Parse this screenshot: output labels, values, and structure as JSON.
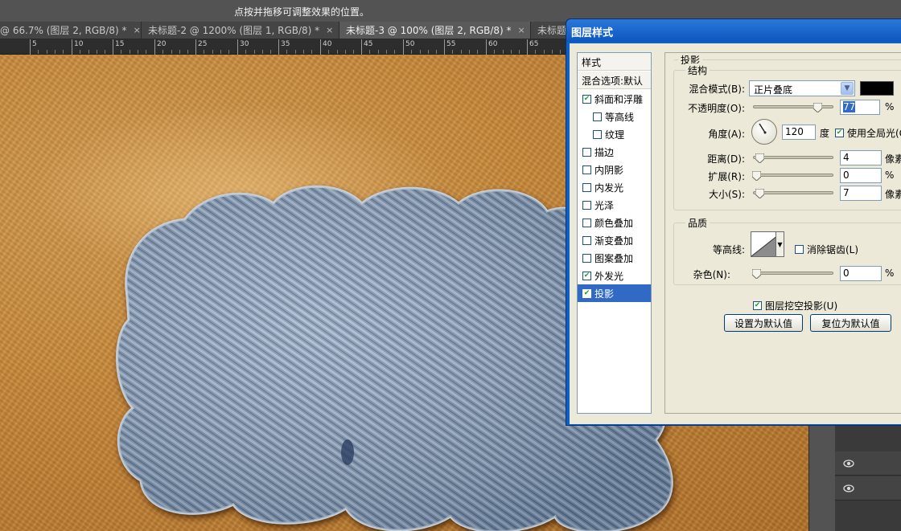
{
  "hint": "点按并拖移可调整效果的位置。",
  "tabs": [
    {
      "label": "@ 66.7% (图层 2, RGB/8) *",
      "close": "×"
    },
    {
      "label": "未标题-2 @ 1200% (图层 1, RGB/8) *",
      "close": "×"
    },
    {
      "label": "未标题-3 @ 100% (图层 2, RGB/8) *",
      "close": "×"
    },
    {
      "label": "未标题",
      "close": ""
    }
  ],
  "ruler": [
    "5",
    "10",
    "15",
    "20",
    "25",
    "30",
    "35",
    "40",
    "45",
    "50",
    "55",
    "60",
    "65"
  ],
  "dialog": {
    "title": "图层样式",
    "styles_header": "样式",
    "blend_options": "混合选项:默认",
    "items": [
      {
        "label": "斜面和浮雕",
        "checked": true,
        "indent": false,
        "selected": false
      },
      {
        "label": "等高线",
        "checked": false,
        "indent": true,
        "selected": false
      },
      {
        "label": "纹理",
        "checked": false,
        "indent": true,
        "selected": false
      },
      {
        "label": "描边",
        "checked": false,
        "indent": false,
        "selected": false
      },
      {
        "label": "内阴影",
        "checked": false,
        "indent": false,
        "selected": false
      },
      {
        "label": "内发光",
        "checked": false,
        "indent": false,
        "selected": false
      },
      {
        "label": "光泽",
        "checked": false,
        "indent": false,
        "selected": false
      },
      {
        "label": "颜色叠加",
        "checked": false,
        "indent": false,
        "selected": false
      },
      {
        "label": "渐变叠加",
        "checked": false,
        "indent": false,
        "selected": false
      },
      {
        "label": "图案叠加",
        "checked": false,
        "indent": false,
        "selected": false
      },
      {
        "label": "外发光",
        "checked": true,
        "indent": false,
        "selected": false
      },
      {
        "label": "投影",
        "checked": true,
        "indent": false,
        "selected": true
      }
    ],
    "section_title": "投影",
    "structure": {
      "legend": "结构",
      "blend_mode_label": "混合模式(B):",
      "blend_mode_value": "正片叠底",
      "blend_color": "#000000",
      "opacity_label": "不透明度(O):",
      "opacity_value": "77",
      "opacity_unit": "%",
      "angle_label": "角度(A):",
      "angle_value": "120",
      "angle_unit": "度",
      "global_light_label": "使用全局光(G)",
      "global_light_checked": true,
      "distance_label": "距离(D):",
      "distance_value": "4",
      "distance_unit": "像素",
      "spread_label": "扩展(R):",
      "spread_value": "0",
      "spread_unit": "%",
      "size_label": "大小(S):",
      "size_value": "7",
      "size_unit": "像素"
    },
    "quality": {
      "legend": "品质",
      "contour_label": "等高线:",
      "antialias_label": "消除锯齿(L)",
      "antialias_checked": false,
      "noise_label": "杂色(N):",
      "noise_value": "0",
      "noise_unit": "%"
    },
    "knockout_label": "图层挖空投影(U)",
    "knockout_checked": true,
    "make_default_label": "设置为默认值",
    "reset_default_label": "复位为默认值"
  }
}
